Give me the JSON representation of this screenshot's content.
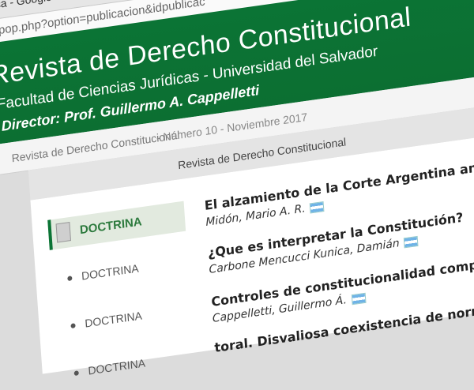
{
  "browser": {
    "window_title": "ídica - Google Chrome",
    "url": "m/pop.php?option=publicacion&idpublicac"
  },
  "header": {
    "title": "Revista de Derecho Constitucional",
    "subtitle": "Facultad de Ciencias Jurídicas - Universidad del Salvador",
    "director": "Director: Prof. Guillermo A. Cappelletti"
  },
  "breadcrumb": {
    "journal": "Revista de Derecho Constitucional",
    "issue": "- Número 10 - Noviembre 2017"
  },
  "issue_bar": {
    "label": "Revista de Derecho Constitucional"
  },
  "section": {
    "label": "DOCTRINA"
  },
  "side_items": [
    "DOCTRINA",
    "DOCTRINA",
    "DOCTRINA",
    "DOCTRINA"
  ],
  "articles": [
    {
      "title": "El alzamiento de la Corte Argentina ante una sentencia de la",
      "author": "Midón, Mario A. R."
    },
    {
      "title": "¿Que es interpretar la Constitución?",
      "author": "Carbone Mencucci Kunica, Damián"
    },
    {
      "title": "Controles de constitucionalidad comparados",
      "author": "Cappelletti, Guillermo Á."
    },
    {
      "title": "toral. Disvaliosa coexistencia de norm",
      "author": ""
    }
  ]
}
